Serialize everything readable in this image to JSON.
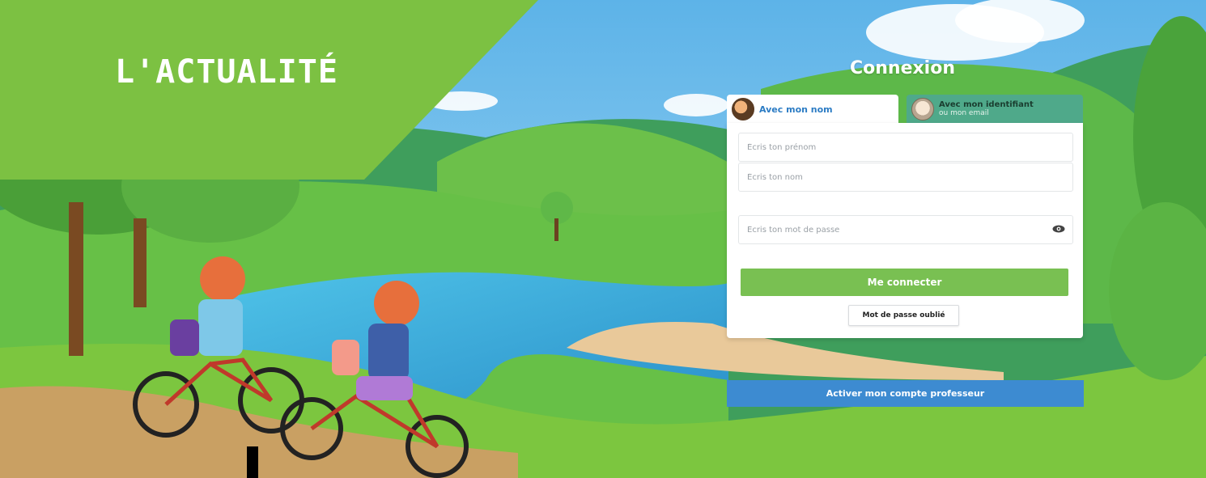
{
  "banner": {
    "text": "L'ACTUALITÉ"
  },
  "login": {
    "title": "Connexion",
    "tabs": [
      {
        "label": "Avec mon nom",
        "subtitle": ""
      },
      {
        "label": "Avec mon identifiant",
        "subtitle": "ou mon email"
      }
    ],
    "fields": {
      "firstname_placeholder": "Écris ton prénom",
      "lastname_placeholder": "Écris ton nom",
      "password_placeholder": "Écris ton mot de passe"
    },
    "login_button": "Me connecter",
    "forgot_button": "Mot de passe oublié",
    "teacher_button": "Activer mon compte professeur"
  },
  "colors": {
    "banner_green": "#7cc142",
    "button_green": "#79c052",
    "teacher_blue": "#3d8bd1",
    "tab_blue_text": "#2c7cc4",
    "inactive_tab": "#4fa98a"
  },
  "icons": {
    "avatar_tab1": "child-avatar-icon",
    "avatar_tab2": "child-avatar-icon",
    "password_toggle": "eye-icon"
  }
}
